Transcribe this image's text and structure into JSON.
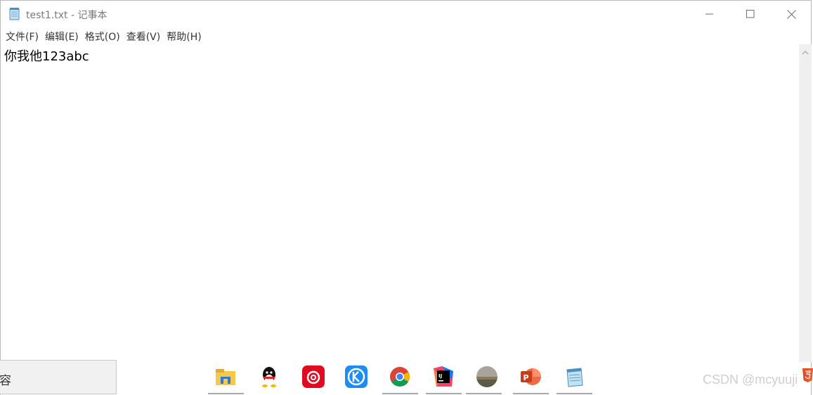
{
  "window": {
    "title": "test1.txt - 记事本",
    "icon": "notepad-icon",
    "controls": [
      "minimize-icon",
      "maximize-icon",
      "close-icon"
    ]
  },
  "menu": [
    {
      "label": "文件(F)"
    },
    {
      "label": "编辑(E)"
    },
    {
      "label": "格式(O)"
    },
    {
      "label": "查看(V)"
    },
    {
      "label": "帮助(H)"
    }
  ],
  "editor": {
    "content": "你我他123abc"
  },
  "taskbar": {
    "left_partial_text": "容",
    "apps": [
      "file-explorer-icon",
      "qq-icon",
      "netease-music-icon",
      "kugou-icon",
      "chrome-icon",
      "intellij-idea-icon",
      "photo-app-icon",
      "powerpoint-icon",
      "notepad-taskbar-icon"
    ]
  },
  "watermark": "CSDN @mcyuuji",
  "colors": {
    "title_text": "#7a7a7a",
    "scrollbar": "#f0f0f0",
    "watermark": "#cfcfcf"
  }
}
